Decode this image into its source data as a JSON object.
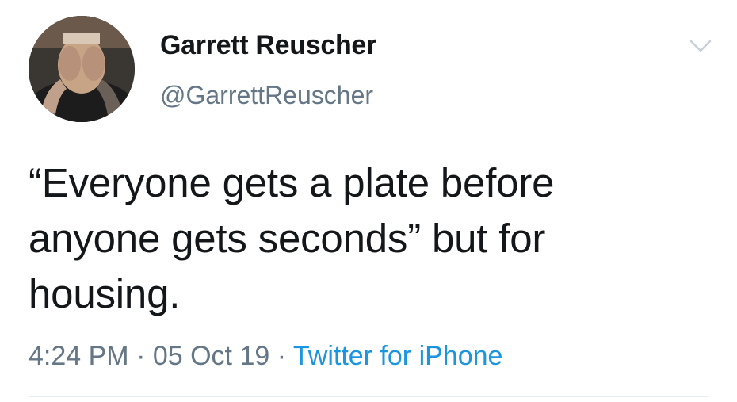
{
  "user": {
    "display_name": "Garrett Reuscher",
    "handle": "@GarrettReuscher"
  },
  "tweet": {
    "text_lines": [
      "“Everyone gets a plate before",
      "anyone gets seconds” but for",
      "housing."
    ],
    "time": "4:24 PM",
    "separator": " · ",
    "date": "05 Oct 19",
    "source": "Twitter for iPhone"
  },
  "icons": {
    "menu": "chevron-down-icon",
    "avatar": "avatar-photo"
  },
  "colors": {
    "text": "#14171a",
    "secondary": "#657786",
    "link": "#1b95e0",
    "divider": "#e6ecf0"
  }
}
